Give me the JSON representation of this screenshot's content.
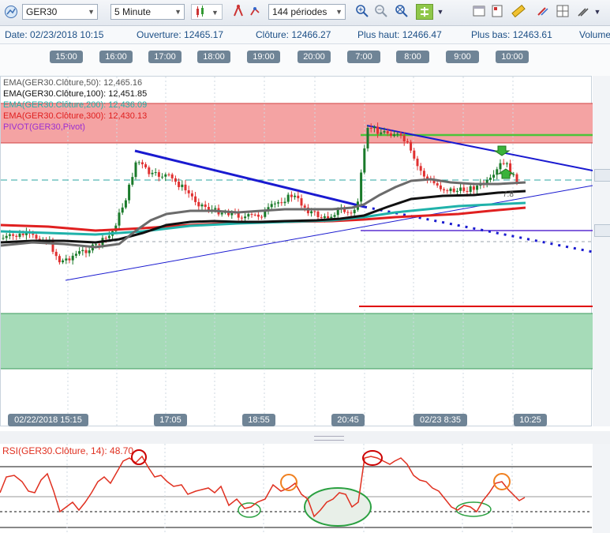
{
  "toolbar": {
    "symbol": "GER30",
    "timeframe": "5 Minute",
    "periods": "144 périodes"
  },
  "info": {
    "date": "Date: 02/23/2018 10:15",
    "open": "Ouverture: 12465.17",
    "close": "Clôture: 12466.27",
    "high": "Plus haut: 12466.47",
    "low": "Plus bas: 12463.61",
    "volume": "Volume"
  },
  "top_axis": [
    "15:00",
    "16:00",
    "17:00",
    "18:00",
    "19:00",
    "20:00",
    "7:00",
    "8:00",
    "9:00",
    "10:00"
  ],
  "bottom_axis": [
    "02/22/2018  15:15",
    "17:05",
    "18:55",
    "20:45",
    "02/23  8:35",
    "10:25"
  ],
  "legend": [
    {
      "text": "EMA(GER30.Clôture,50): 12,465.16",
      "color": "#555555"
    },
    {
      "text": "EMA(GER30.Clôture,100): 12,451.85",
      "color": "#111111"
    },
    {
      "text": "EMA(GER30.Clôture,200): 12,436.09",
      "color": "#20b2aa"
    },
    {
      "text": "EMA(GER30.Clôture,300): 12,430.13",
      "color": "#e02020"
    },
    {
      "text": "PIVOT(GER30,Pivot)",
      "color": "#9b30d0"
    }
  ],
  "chart_annotation": "7.8",
  "rsi": {
    "label": "RSI(GER30.Clôture, 14): 48.70"
  },
  "colors": {
    "resistance_zone": "#f4a3a3",
    "support_zone": "#a6dbb8",
    "bull": "#1a7a2a",
    "bear": "#e03030",
    "trend": "#1a1ad0"
  },
  "chart_data": {
    "type": "candlestick",
    "series": [
      {
        "name": "EMA(GER30.Clôture,50)",
        "last": 12465.16
      },
      {
        "name": "EMA(GER30.Clôture,100)",
        "last": 12451.85
      },
      {
        "name": "EMA(GER30.Clôture,200)",
        "last": 12436.09
      },
      {
        "name": "EMA(GER30.Clôture,300)",
        "last": 12430.13
      },
      {
        "name": "PIVOT(GER30,Pivot)"
      }
    ],
    "last_bar": {
      "date": "02/23/2018 10:15",
      "open": 12465.17,
      "close": 12466.27,
      "high": 12466.47,
      "low": 12463.61
    },
    "rsi_last": 48.7
  }
}
